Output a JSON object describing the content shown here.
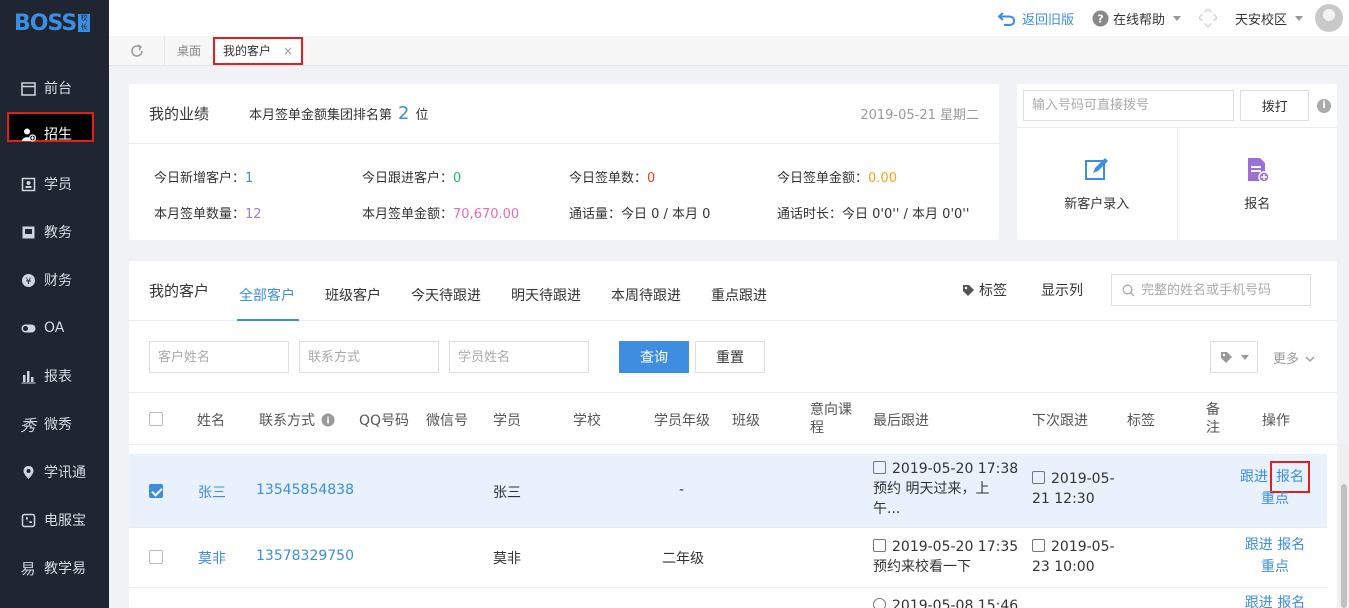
{
  "sidebar": {
    "brand": "BOSS",
    "brand_sub": "校长",
    "items": [
      {
        "label": "前台",
        "icon": "calendar-icon"
      },
      {
        "label": "招生",
        "icon": "add-user-icon"
      },
      {
        "label": "学员",
        "icon": "id-card-icon"
      },
      {
        "label": "教务",
        "icon": "book-icon"
      },
      {
        "label": "财务",
        "icon": "yen-icon"
      },
      {
        "label": "OA",
        "icon": "toggle-icon"
      },
      {
        "label": "报表",
        "icon": "bar-chart-icon"
      },
      {
        "label": "微秀",
        "icon": "xiu-icon"
      },
      {
        "label": "学讯通",
        "icon": "location-icon"
      },
      {
        "label": "电服宝",
        "icon": "phone-icon"
      },
      {
        "label": "教学易",
        "icon": "teach-icon"
      }
    ]
  },
  "topbar": {
    "back_label": "返回旧版",
    "help_label": "在线帮助",
    "campus_label": "天安校区"
  },
  "tabstrip": {
    "desk_label": "桌面",
    "current_label": "我的客户",
    "close": "×"
  },
  "performance": {
    "title": "我的业绩",
    "rank_prefix": "本月签单金额集团排名第",
    "rank_value": "2",
    "rank_suffix": "位",
    "date": "2019-05-21 星期二",
    "stats": {
      "today_new_label": "今日新增客户：",
      "today_new": "1",
      "today_follow_label": "今日跟进客户：",
      "today_follow": "0",
      "today_orders_label": "今日签单数：",
      "today_orders": "0",
      "today_amount_label": "今日签单金额：",
      "today_amount": "0.00",
      "month_orders_label": "本月签单数量：",
      "month_orders": "12",
      "month_amount_label": "本月签单金额：",
      "month_amount": "70,670.00",
      "calls": "通话量：今日 0 / 本月 0",
      "duration": "通话时长：今日 0'0'' / 本月 0'0''"
    }
  },
  "dial": {
    "placeholder": "输入号码可直接拨号",
    "call_label": "拨打",
    "new_customer_label": "新客户录入",
    "enroll_label": "报名"
  },
  "customers": {
    "title": "我的客户",
    "tabs": [
      "全部客户",
      "班级客户",
      "今天待跟进",
      "明天待跟进",
      "本周待跟进",
      "重点跟进"
    ],
    "tag_label": "标签",
    "columns_label": "显示列",
    "search_placeholder": "完整的姓名或手机号码",
    "filters": {
      "name_placeholder": "客户姓名",
      "contact_placeholder": "联系方式",
      "student_placeholder": "学员姓名",
      "query_label": "查询",
      "reset_label": "重置",
      "more_label": "更多"
    },
    "headers": {
      "name": "姓名",
      "contact": "联系方式",
      "qq": "QQ号码",
      "wechat": "微信号",
      "student": "学员",
      "school": "学校",
      "grade": "学员年级",
      "class": "班级",
      "course_1": "意向课",
      "course_2": "程",
      "last": "最后跟进",
      "next": "下次跟进",
      "tag": "标签",
      "note_1": "备",
      "note_2": "注",
      "ops": "操作"
    },
    "rows": [
      {
        "name": "张三",
        "phone": "13545854838",
        "student": "张三",
        "grade": "-",
        "last_1": "2019-05-20 17:38",
        "last_2": "预约 明天过来，上",
        "last_3": "午...",
        "next_1": "2019-05-",
        "next_2": "21 12:30",
        "op_follow": "跟进",
        "op_enroll": "报名",
        "op_key": "重点"
      },
      {
        "name": "莫非",
        "phone": "13578329750",
        "student": "莫非",
        "grade": "二年级",
        "last_1": "2019-05-20 17:35",
        "last_2": "预约来校看一下",
        "next_1": "2019-05-",
        "next_2": "23 10:00",
        "op_follow": "跟进",
        "op_enroll": "报名",
        "op_key": "重点"
      },
      {
        "last_1": "2019-05-08 15:46",
        "op_follow": "跟进",
        "op_enroll": "报名"
      }
    ]
  }
}
